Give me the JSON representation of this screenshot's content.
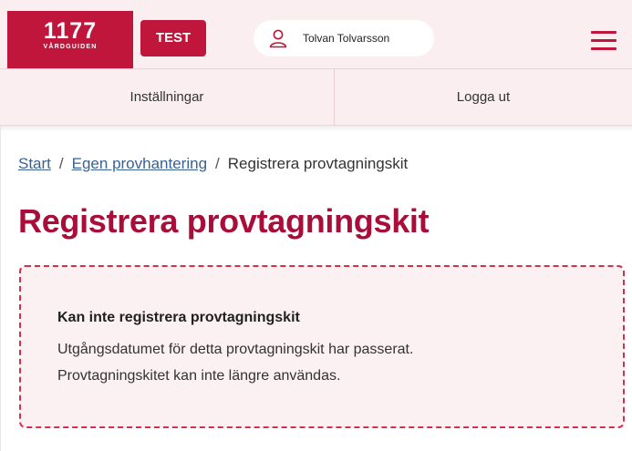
{
  "header": {
    "logo_number": "1177",
    "logo_text": "VÅRDGUIDEN",
    "test_badge": "TEST",
    "user_name": "Tolvan Tolvarsson",
    "brand_color": "#c0163c",
    "icons": {
      "user": "user-icon",
      "menu": "hamburger-menu-icon"
    }
  },
  "subnav": {
    "settings": "Inställningar",
    "logout": "Logga ut"
  },
  "breadcrumb": {
    "items": [
      "Start",
      "Egen provhantering"
    ],
    "separator": "/",
    "current": "Registrera provtagningskit"
  },
  "page": {
    "title": "Registrera provtagningskit",
    "title_color": "#a90e3b"
  },
  "alert": {
    "title": "Kan inte registrera provtagningskit",
    "line1": "Utgångsdatumet för detta provtagningskit har passerat.",
    "line2": "Provtagningskitet kan inte längre användas."
  }
}
